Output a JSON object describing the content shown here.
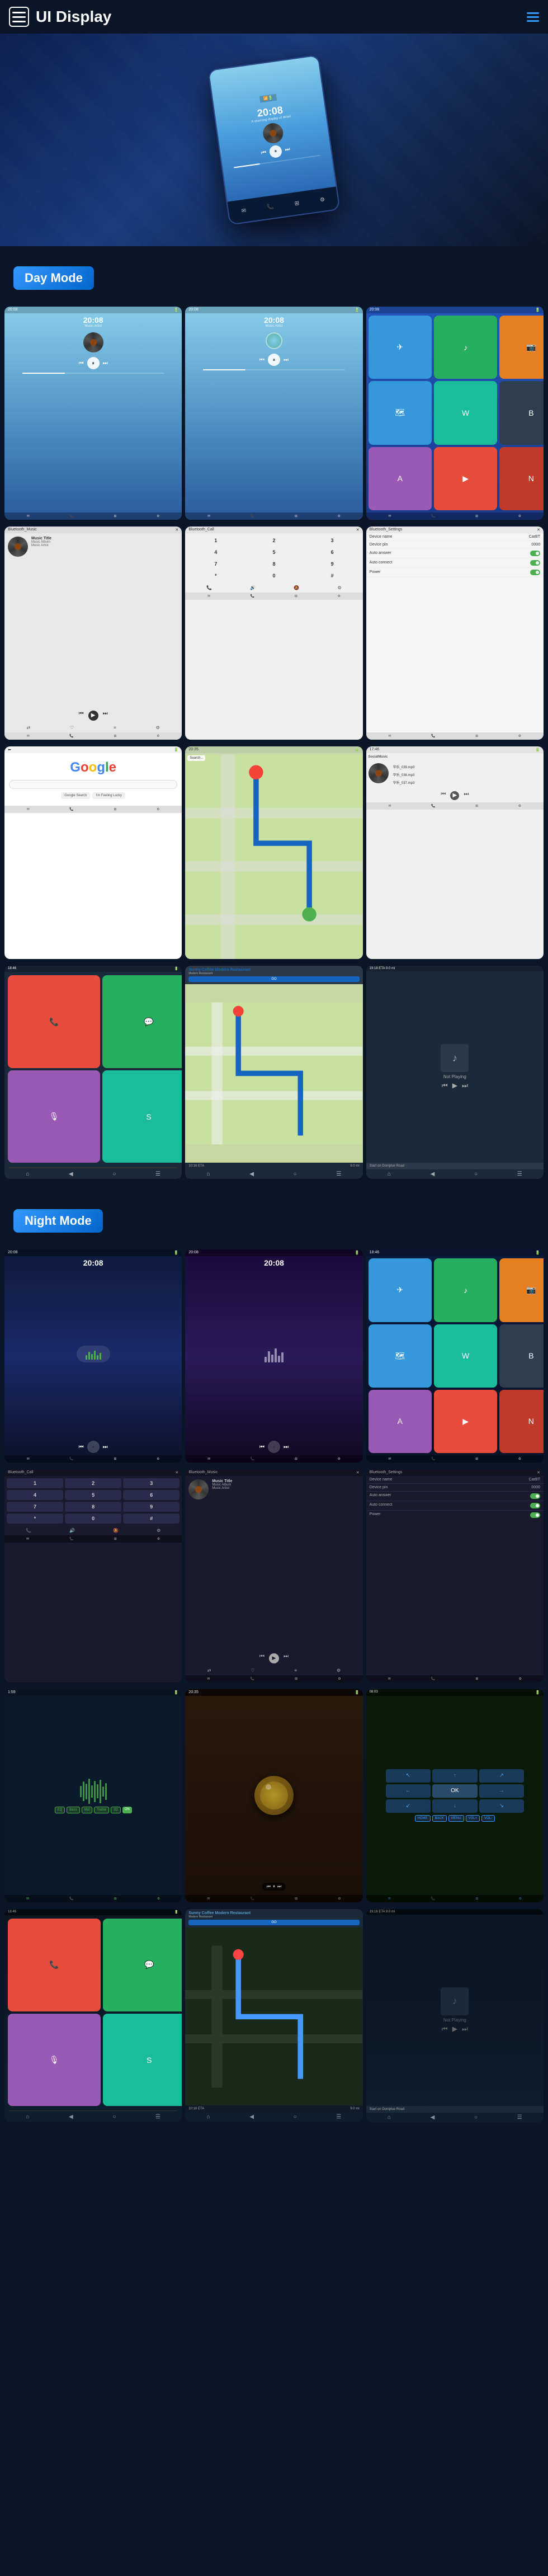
{
  "header": {
    "title": "UI Display",
    "menu_icon_label": "menu",
    "nav_icon_label": "navigation"
  },
  "hero": {
    "device_time": "20:08",
    "device_subtitle": "A stunning display of detail"
  },
  "day_mode": {
    "label": "Day Mode",
    "screens": [
      {
        "id": "music1",
        "type": "music",
        "time": "20:08",
        "subtitle": "Music Artist"
      },
      {
        "id": "music2",
        "type": "music",
        "time": "20:08",
        "subtitle": "Music Artist"
      },
      {
        "id": "apps1",
        "type": "apps"
      },
      {
        "id": "bt_music",
        "type": "bluetooth_music",
        "title": "Music Title",
        "album": "Music Album",
        "artist": "Music Artist"
      },
      {
        "id": "bt_call",
        "type": "bluetooth_call"
      },
      {
        "id": "bt_settings",
        "type": "bluetooth_settings",
        "device_name_label": "Device name",
        "device_name": "CarBT",
        "device_pin_label": "Device pin",
        "device_pin": "0000",
        "auto_answer": "Auto answer",
        "auto_connect": "Auto connect",
        "power": "Power"
      },
      {
        "id": "google",
        "type": "google"
      },
      {
        "id": "maps",
        "type": "maps"
      },
      {
        "id": "social",
        "type": "social_music"
      }
    ]
  },
  "carplay_day": {
    "screens": [
      {
        "id": "cp1",
        "type": "carplay_apps"
      },
      {
        "id": "cp2",
        "type": "carplay_nav",
        "restaurant": "Sunny Coffee Modern Restaurant",
        "address": "1234 Coffee Street",
        "go": "GO",
        "eta_label": "10:16 ETA",
        "eta_value": "9.0 mi"
      },
      {
        "id": "cp3",
        "type": "carplay_music",
        "not_playing": "Not Playing",
        "road": "Start on Doniplue Road"
      }
    ]
  },
  "night_mode": {
    "label": "Night Mode",
    "screens": [
      {
        "id": "n_music1",
        "type": "music_night",
        "time": "20:08"
      },
      {
        "id": "n_music2",
        "type": "music_night2",
        "time": "20:08"
      },
      {
        "id": "n_apps",
        "type": "apps_night"
      },
      {
        "id": "n_bt_call",
        "type": "bt_call_night"
      },
      {
        "id": "n_bt_music",
        "type": "bt_music_night",
        "title": "Music Title",
        "album": "Music Album",
        "artist": "Music Artist"
      },
      {
        "id": "n_bt_settings",
        "type": "bt_settings_night",
        "device_name_label": "Device name",
        "device_name": "CarBT",
        "device_pin_label": "Device pin",
        "device_pin": "0000",
        "auto_answer": "Auto answer",
        "auto_connect": "Auto connect",
        "power": "Power"
      },
      {
        "id": "n_waveform",
        "type": "waveform_night"
      },
      {
        "id": "n_food",
        "type": "food_night"
      },
      {
        "id": "n_nav",
        "type": "nav_night"
      }
    ]
  },
  "carplay_night": {
    "screens": [
      {
        "id": "ncp1",
        "type": "carplay_apps_night"
      },
      {
        "id": "ncp2",
        "type": "carplay_nav_night",
        "restaurant": "Sunny Coffee Modern Restaurant",
        "go": "GO",
        "eta_label": "10:16 ETA",
        "eta_value": "9.0 mi"
      },
      {
        "id": "ncp3",
        "type": "carplay_music_night",
        "not_playing": "Not Playing",
        "road": "Start on Doniplue Road"
      }
    ]
  },
  "bottom_icons": {
    "email": "EMAIL",
    "dial": "DIAL",
    "apps": "APPS",
    "auto": "AUTO"
  }
}
